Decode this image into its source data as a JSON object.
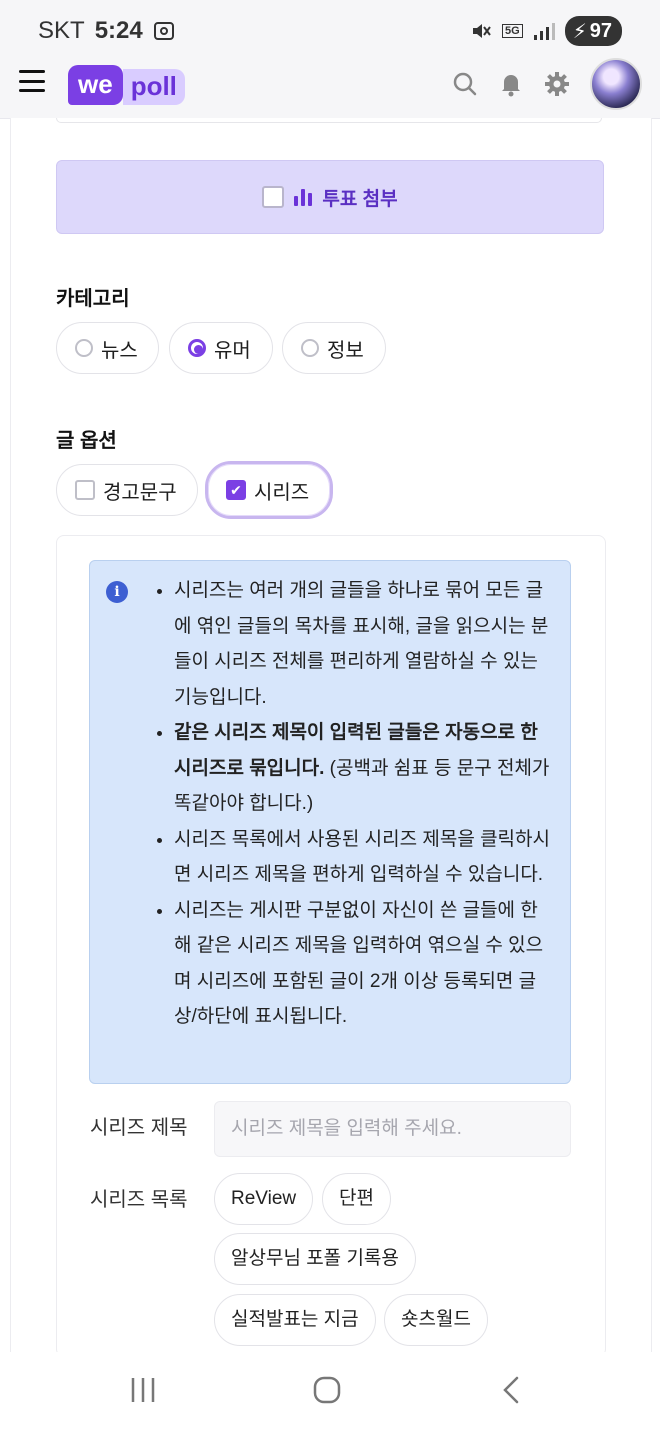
{
  "status_bar": {
    "carrier": "SKT",
    "time": "5:24",
    "network": "5G",
    "battery": "97"
  },
  "app_bar": {
    "logo_part1": "we",
    "logo_part2": "poll",
    "icons": [
      "menu-icon",
      "search-icon",
      "bell-icon",
      "gear-icon",
      "avatar"
    ]
  },
  "poll_attach": {
    "label": "투표 첨부",
    "checked": false
  },
  "category": {
    "title": "카테고리",
    "options": [
      "뉴스",
      "유머",
      "정보"
    ],
    "selected": "유머"
  },
  "post_options": {
    "title": "글 옵션",
    "options": [
      {
        "label": "경고문구",
        "checked": false
      },
      {
        "label": "시리즈",
        "checked": true
      }
    ]
  },
  "series_info": {
    "bullets": [
      {
        "bold": "",
        "text": "시리즈는 여러 개의 글들을 하나로 묶어 모든 글에 엮인 글들의 목차를 표시해, 글을 읽으시는 분들이 시리즈 전체를 편리하게 열람하실 수 있는 기능입니다."
      },
      {
        "bold": "같은 시리즈 제목이 입력된 글들은 자동으로 한 시리즈로 묶입니다.",
        "text": " (공백과 쉼표 등 문구 전체가 똑같아야 합니다.)"
      },
      {
        "bold": "",
        "text": "시리즈 목록에서 사용된 시리즈 제목을 클릭하시면 시리즈 제목을 편하게 입력하실 수 있습니다."
      },
      {
        "bold": "",
        "text": "시리즈는 게시판 구분없이 자신이 쓴 글들에 한해 같은 시리즈 제목을 입력하여 엮으실 수 있으며 시리즈에 포함된 글이 2개 이상 등록되면 글 상/하단에 표시됩니다."
      }
    ]
  },
  "series_title": {
    "label": "시리즈 제목",
    "placeholder": "시리즈 제목을 입력해 주세요.",
    "value": ""
  },
  "series_list": {
    "label": "시리즈 목록",
    "items": [
      "ReView",
      "단편",
      "알상무님 포폴 기록용",
      "실적발표는 지금",
      "숏츠월드"
    ]
  },
  "colors": {
    "accent": "#7b3fe4",
    "poll_bg": "#ddd8fb",
    "info_bg": "#d7e6fb"
  }
}
